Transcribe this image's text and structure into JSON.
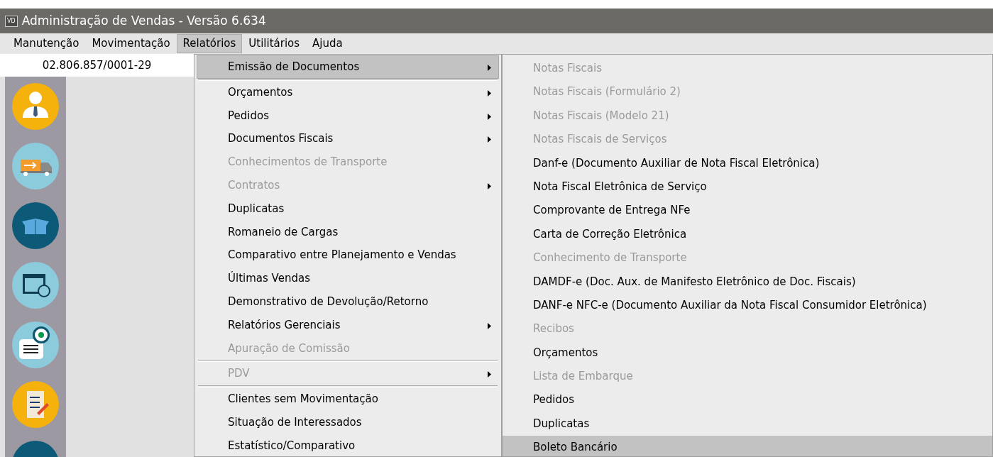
{
  "window": {
    "logo": "VD",
    "title": "Administração de Vendas - Versão 6.634"
  },
  "menu_bar": [
    {
      "label": "Manutenção",
      "selected": false
    },
    {
      "label": "Movimentação",
      "selected": false
    },
    {
      "label": "Relatórios",
      "selected": true
    },
    {
      "label": "Utilitários",
      "selected": false
    },
    {
      "label": "Ajuda",
      "selected": false
    }
  ],
  "company_id": "02.806.857/0001-29",
  "sidebar": {
    "items": [
      {
        "kind": "person"
      },
      {
        "kind": "truck"
      },
      {
        "kind": "box"
      },
      {
        "kind": "calendar"
      },
      {
        "kind": "bill"
      },
      {
        "kind": "scroll"
      },
      {
        "kind": "partial"
      }
    ]
  },
  "menu": [
    {
      "kind": "item",
      "label": "Emissão de Documentos",
      "disabled": false,
      "submenu": true,
      "selected": true
    },
    {
      "kind": "separator"
    },
    {
      "kind": "item",
      "label": "Orçamentos",
      "disabled": false,
      "submenu": true,
      "selected": false
    },
    {
      "kind": "item",
      "label": "Pedidos",
      "disabled": false,
      "submenu": true,
      "selected": false
    },
    {
      "kind": "item",
      "label": "Documentos Fiscais",
      "disabled": false,
      "submenu": true,
      "selected": false
    },
    {
      "kind": "item",
      "label": "Conhecimentos de Transporte",
      "disabled": true,
      "submenu": false,
      "selected": false
    },
    {
      "kind": "item",
      "label": "Contratos",
      "disabled": true,
      "submenu": true,
      "selected": false
    },
    {
      "kind": "item",
      "label": "Duplicatas",
      "disabled": false,
      "submenu": false,
      "selected": false
    },
    {
      "kind": "item",
      "label": "Romaneio de Cargas",
      "disabled": false,
      "submenu": false,
      "selected": false
    },
    {
      "kind": "item",
      "label": "Comparativo entre Planejamento e Vendas",
      "disabled": false,
      "submenu": false,
      "selected": false
    },
    {
      "kind": "item",
      "label": "Últimas Vendas",
      "disabled": false,
      "submenu": false,
      "selected": false
    },
    {
      "kind": "item",
      "label": "Demonstrativo de Devolução/Retorno",
      "disabled": false,
      "submenu": false,
      "selected": false
    },
    {
      "kind": "item",
      "label": "Relatórios Gerenciais",
      "disabled": false,
      "submenu": true,
      "selected": false
    },
    {
      "kind": "item",
      "label": "Apuração de Comissão",
      "disabled": true,
      "submenu": false,
      "selected": false
    },
    {
      "kind": "separator"
    },
    {
      "kind": "item",
      "label": "PDV",
      "disabled": true,
      "submenu": true,
      "selected": false
    },
    {
      "kind": "separator"
    },
    {
      "kind": "item",
      "label": "Clientes sem Movimentação",
      "disabled": false,
      "submenu": false,
      "selected": false
    },
    {
      "kind": "item",
      "label": "Situação de Interessados",
      "disabled": false,
      "submenu": false,
      "selected": false
    },
    {
      "kind": "item",
      "label": "Estatístico/Comparativo",
      "disabled": false,
      "submenu": false,
      "selected": false
    }
  ],
  "submenu": [
    {
      "label": "Notas Fiscais",
      "disabled": true,
      "selected": false
    },
    {
      "label": "Notas Fiscais (Formulário 2)",
      "disabled": true,
      "selected": false
    },
    {
      "label": "Notas Fiscais (Modelo 21)",
      "disabled": true,
      "selected": false
    },
    {
      "label": "Notas Fiscais de Serviços",
      "disabled": true,
      "selected": false
    },
    {
      "label": "Danf-e (Documento Auxiliar de Nota Fiscal Eletrônica)",
      "disabled": false,
      "selected": false
    },
    {
      "label": "Nota Fiscal Eletrônica de Serviço",
      "disabled": false,
      "selected": false
    },
    {
      "label": "Comprovante de Entrega NFe",
      "disabled": false,
      "selected": false
    },
    {
      "label": "Carta de Correção Eletrônica",
      "disabled": false,
      "selected": false
    },
    {
      "label": "Conhecimento de Transporte",
      "disabled": true,
      "selected": false
    },
    {
      "label": "DAMDF-e (Doc. Aux. de Manifesto Eletrônico de Doc. Fiscais)",
      "disabled": false,
      "selected": false
    },
    {
      "label": "DANF-e NFC-e (Documento Auxiliar da Nota Fiscal Consumidor Eletrônica)",
      "disabled": false,
      "selected": false
    },
    {
      "label": "Recibos",
      "disabled": true,
      "selected": false
    },
    {
      "label": "Orçamentos",
      "disabled": false,
      "selected": false
    },
    {
      "label": "Lista de Embarque",
      "disabled": true,
      "selected": false
    },
    {
      "label": "Pedidos",
      "disabled": false,
      "selected": false
    },
    {
      "label": "Duplicatas",
      "disabled": false,
      "selected": false
    },
    {
      "label": "Boleto Bancário",
      "disabled": false,
      "selected": true
    }
  ]
}
